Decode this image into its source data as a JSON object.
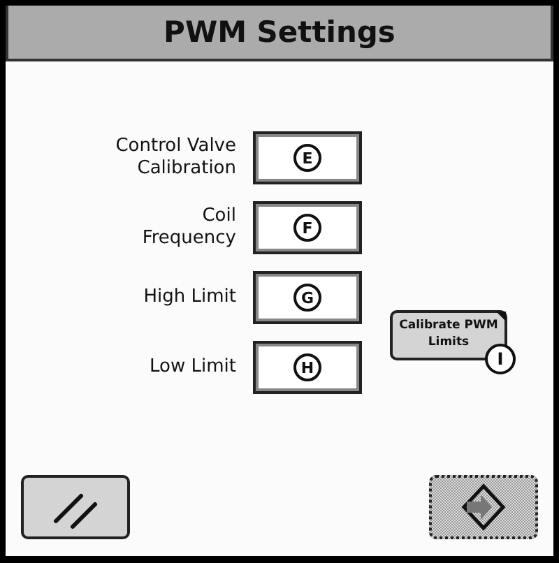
{
  "window": {
    "title": "PWM Settings"
  },
  "settings": [
    {
      "label_lines": [
        "Control Valve",
        "Calibration"
      ],
      "callout": "E"
    },
    {
      "label_lines": [
        "Coil",
        "Frequency"
      ],
      "callout": "F"
    },
    {
      "label_lines": [
        "High Limit"
      ],
      "callout": "G"
    },
    {
      "label_lines": [
        "Low Limit"
      ],
      "callout": "H"
    }
  ],
  "calibrate_button": {
    "label": "Calibrate PWM Limits",
    "callout": "I"
  },
  "footer": {
    "cancel": {
      "disabled": false
    },
    "next": {
      "disabled": true
    }
  }
}
